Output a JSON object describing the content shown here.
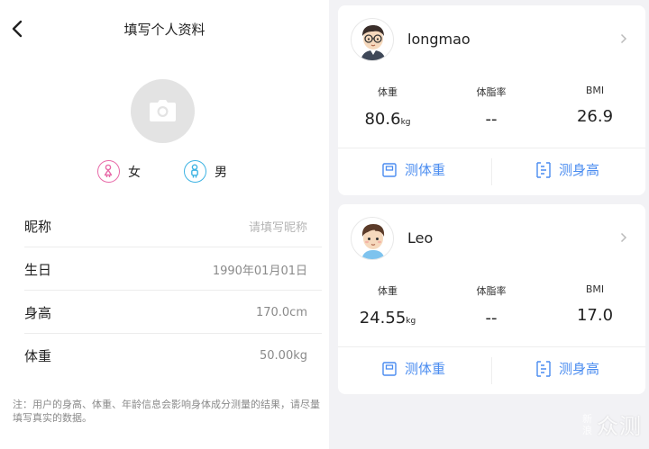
{
  "profile_form": {
    "title": "填写个人资料",
    "genders": [
      {
        "label": "女"
      },
      {
        "label": "男"
      }
    ],
    "fields": [
      {
        "label": "昵称",
        "value": "",
        "placeholder": "请填写昵称"
      },
      {
        "label": "生日",
        "value": "1990年01月01日"
      },
      {
        "label": "身高",
        "value": "170.0cm"
      },
      {
        "label": "体重",
        "value": "50.00kg"
      }
    ],
    "note": "注：用户的身高、体重、年龄信息会影响身体成分测量的结果，请尽量填写真实的数据。"
  },
  "members": [
    {
      "name": "longmao",
      "stats": [
        {
          "label": "体重",
          "value": "80.6",
          "unit": "kg"
        },
        {
          "label": "体脂率",
          "value": "--",
          "unit": ""
        },
        {
          "label": "BMI",
          "value": "26.9",
          "unit": ""
        }
      ],
      "actions": {
        "weigh": "测体重",
        "height": "测身高"
      }
    },
    {
      "name": "Leo",
      "stats": [
        {
          "label": "体重",
          "value": "24.55",
          "unit": "kg"
        },
        {
          "label": "体脂率",
          "value": "--",
          "unit": ""
        },
        {
          "label": "BMI",
          "value": "17.0",
          "unit": ""
        }
      ],
      "actions": {
        "weigh": "测体重",
        "height": "测身高"
      }
    }
  ],
  "watermark": {
    "small": "新浪",
    "big": "众测"
  },
  "colors": {
    "accent": "#4a8cf0",
    "female": "#e86aa8",
    "male": "#3db3e3",
    "right_bg": "#f2f2f5"
  }
}
